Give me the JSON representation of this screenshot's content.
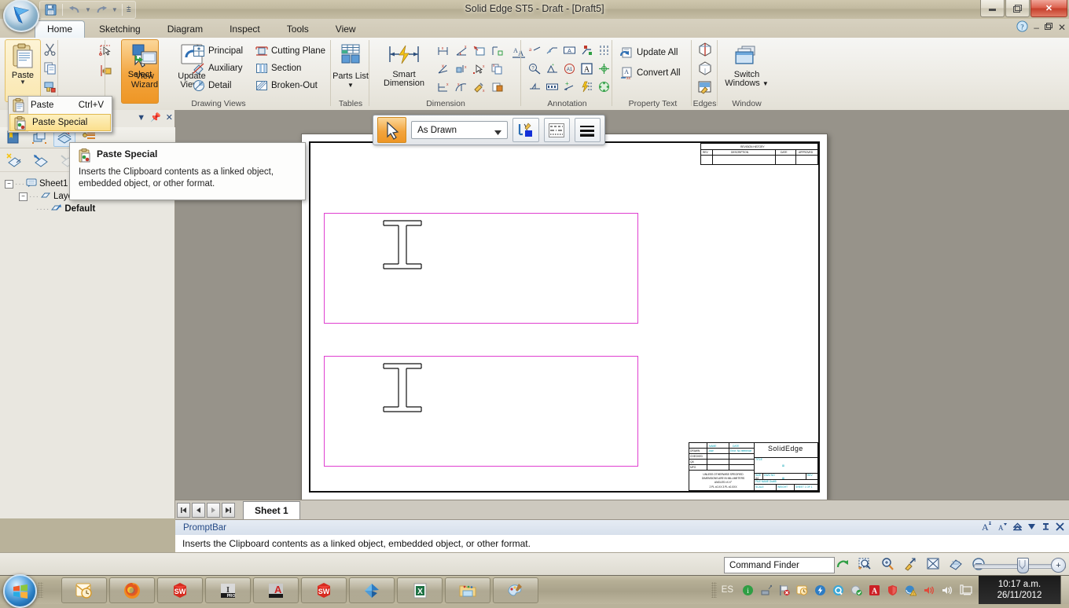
{
  "window": {
    "title": "Solid Edge ST5 - Draft - [Draft5]",
    "minimize": "–",
    "restore": "❐",
    "close": "✕",
    "doc_minimize": "–",
    "doc_restore": "❐",
    "doc_close": "✕"
  },
  "quick_access": {
    "save": "save-icon",
    "undo": "undo-icon",
    "redo": "redo-icon",
    "customize": "customize-icon"
  },
  "ribbon": {
    "tabs": [
      {
        "label": "Home",
        "active": true
      },
      {
        "label": "Sketching",
        "active": false
      },
      {
        "label": "Diagram",
        "active": false
      },
      {
        "label": "Inspect",
        "active": false
      },
      {
        "label": "Tools",
        "active": false
      },
      {
        "label": "View",
        "active": false
      }
    ],
    "help_icon": "help-icon",
    "groups": [
      {
        "label": "",
        "items": [
          {
            "label": "Paste",
            "icon": "paste-icon",
            "split": true
          },
          {
            "label": "",
            "icon": "cut-icon"
          },
          {
            "label": "",
            "icon": "copy-icon"
          },
          {
            "label": "",
            "icon": "format-painter-icon"
          }
        ]
      },
      {
        "label": "",
        "items": [
          {
            "label": "Select",
            "icon": "select-arrow-icon"
          },
          {
            "label": "",
            "icon": "select-tool-icon"
          },
          {
            "label": "",
            "icon": "select-edge-icon"
          }
        ]
      },
      {
        "label": "Drawing Views",
        "items": [
          {
            "label": "View Wizard",
            "icon": "view-wizard-icon"
          },
          {
            "label": "Update Views",
            "icon": "update-views-icon"
          },
          {
            "label": "Principal",
            "icon": "principal-icon"
          },
          {
            "label": "Auxiliary",
            "icon": "auxiliary-icon"
          },
          {
            "label": "Detail",
            "icon": "detail-icon"
          },
          {
            "label": "Cutting Plane",
            "icon": "cutting-plane-icon"
          },
          {
            "label": "Section",
            "icon": "section-icon"
          },
          {
            "label": "Broken-Out",
            "icon": "broken-out-icon"
          }
        ]
      },
      {
        "label": "Tables",
        "items": [
          {
            "label": "Parts List",
            "icon": "parts-list-icon",
            "split": true
          }
        ]
      },
      {
        "label": "Dimension",
        "items": [
          {
            "label": "Smart Dimension",
            "icon": "smart-dimension-icon"
          }
        ]
      },
      {
        "label": "Annotation",
        "items": []
      },
      {
        "label": "Property Text",
        "items": [
          {
            "label": "Update All",
            "icon": "update-all-icon"
          },
          {
            "label": "Convert All",
            "icon": "convert-all-icon"
          }
        ]
      },
      {
        "label": "Edges",
        "items": []
      },
      {
        "label": "Window",
        "items": [
          {
            "label": "Switch Windows",
            "icon": "switch-windows-icon",
            "split": true
          }
        ]
      }
    ]
  },
  "paste_menu": {
    "items": [
      {
        "label": "Paste",
        "shortcut": "Ctrl+V",
        "icon": "paste-icon",
        "selected": false
      },
      {
        "label": "Paste Special",
        "shortcut": "",
        "icon": "paste-special-icon",
        "selected": true
      }
    ]
  },
  "tooltip": {
    "title": "Paste Special",
    "icon": "paste-special-icon",
    "body": "Inserts the Clipboard contents as a linked object, embedded object, or other format."
  },
  "left_panel": {
    "caption_buttons": [
      "dropdown-icon",
      "pin-icon",
      "close-icon"
    ],
    "tabs": [
      "library-icon",
      "layers-stack-icon",
      "sheets-icon",
      "properties-icon"
    ],
    "tools": [
      "new-layer-icon",
      "edit-layer-icon",
      "delete-layer-icon"
    ],
    "tree": [
      {
        "label": "Sheet1",
        "icon": "sheet-icon",
        "level": 0,
        "expander": "-",
        "bold": false
      },
      {
        "label": "Layers",
        "icon": "layer-icon",
        "level": 1,
        "expander": "-",
        "bold": false
      },
      {
        "label": "Default",
        "icon": "layer-active-icon",
        "level": 2,
        "expander": "",
        "bold": true
      }
    ]
  },
  "float_toolbar": {
    "select_icon": "select-arrow-icon",
    "style_value": "As Drawn",
    "style_caret": "▼",
    "buttons": [
      "fill-style-icon",
      "line-style-icon",
      "line-width-icon"
    ]
  },
  "sheet": {
    "views": [
      {
        "name": "drawing-view-1"
      },
      {
        "name": "drawing-view-2"
      }
    ],
    "title_block": {
      "company": "SolidEdge",
      "revision_header": "REVISION HISTORY",
      "revision_columns": [
        "REV",
        "DESCRIPTION",
        "DATE",
        "APPROVED"
      ],
      "rows": [
        {
          "label": "DRAWN",
          "name": "Jose",
          "date": "Error: No reference"
        },
        {
          "label": "CHECKED",
          "name": "",
          "date": ""
        },
        {
          "label": "QA",
          "name": "",
          "date": ""
        },
        {
          "label": "MFG",
          "name": "",
          "date": ""
        }
      ],
      "notes": [
        "UNLESS OTHERWISE SPECIFIED",
        "DIMENSIONS ARE IN MILLIMETERS",
        "ANGLES ±X.X°",
        "2 PL ±0.XX  3 PL ±0.XXX"
      ],
      "fields": [
        "TITLE",
        "SIZE",
        "DWG NO",
        "REV",
        "FILE NAME",
        "SCALE",
        "WEIGHT",
        "SHEET 1 OF 1"
      ],
      "size_label": "A4",
      "file_name": "Draft5"
    }
  },
  "sheet_tabs": {
    "nav": [
      "first-icon",
      "prev-icon",
      "next-icon",
      "last-icon"
    ],
    "tabs": [
      {
        "label": "Sheet 1",
        "active": true
      }
    ]
  },
  "prompt_bar": {
    "title": "PromptBar",
    "message": "Inserts the Clipboard contents as a linked object, embedded object, or other format.",
    "controls": [
      "increase-font-icon",
      "decrease-font-icon",
      "collapse-icon",
      "dropdown-icon",
      "pin-icon",
      "close-icon"
    ]
  },
  "status_bar": {
    "command_finder_placeholder": "Command Finder",
    "command_finder_value": "",
    "icons": [
      "go-icon",
      "zoom-area-icon",
      "zoom-icon",
      "pan-icon",
      "fit-icon",
      "sketch-view-icon",
      "zoom-out-icon"
    ],
    "zoom_minus": "−",
    "zoom_plus": "+"
  },
  "taskbar": {
    "start": "windows-start-icon",
    "buttons": [
      {
        "name": "outlook-icon"
      },
      {
        "name": "firefox-icon"
      },
      {
        "name": "solidworks-icon"
      },
      {
        "name": "inventor-pro-icon"
      },
      {
        "name": "autocad-icon"
      },
      {
        "name": "solidworks-icon"
      },
      {
        "name": "solid-edge-icon"
      },
      {
        "name": "excel-icon"
      },
      {
        "name": "explorer-folder-icon"
      },
      {
        "name": "paint-icon"
      }
    ],
    "tray": {
      "language": "ES",
      "icons": [
        "info-icon",
        "network-icon",
        "flag-error-icon",
        "outlook-tray-icon",
        "flash-icon",
        "quicktime-icon",
        "installer-icon",
        "adobe-icon",
        "defender-icon",
        "warning-icon",
        "volume-mute-icon"
      ],
      "right_icons": [
        "speaker-icon",
        "display-icon"
      ],
      "time": "10:17 a.m.",
      "date": "26/11/2012"
    }
  }
}
